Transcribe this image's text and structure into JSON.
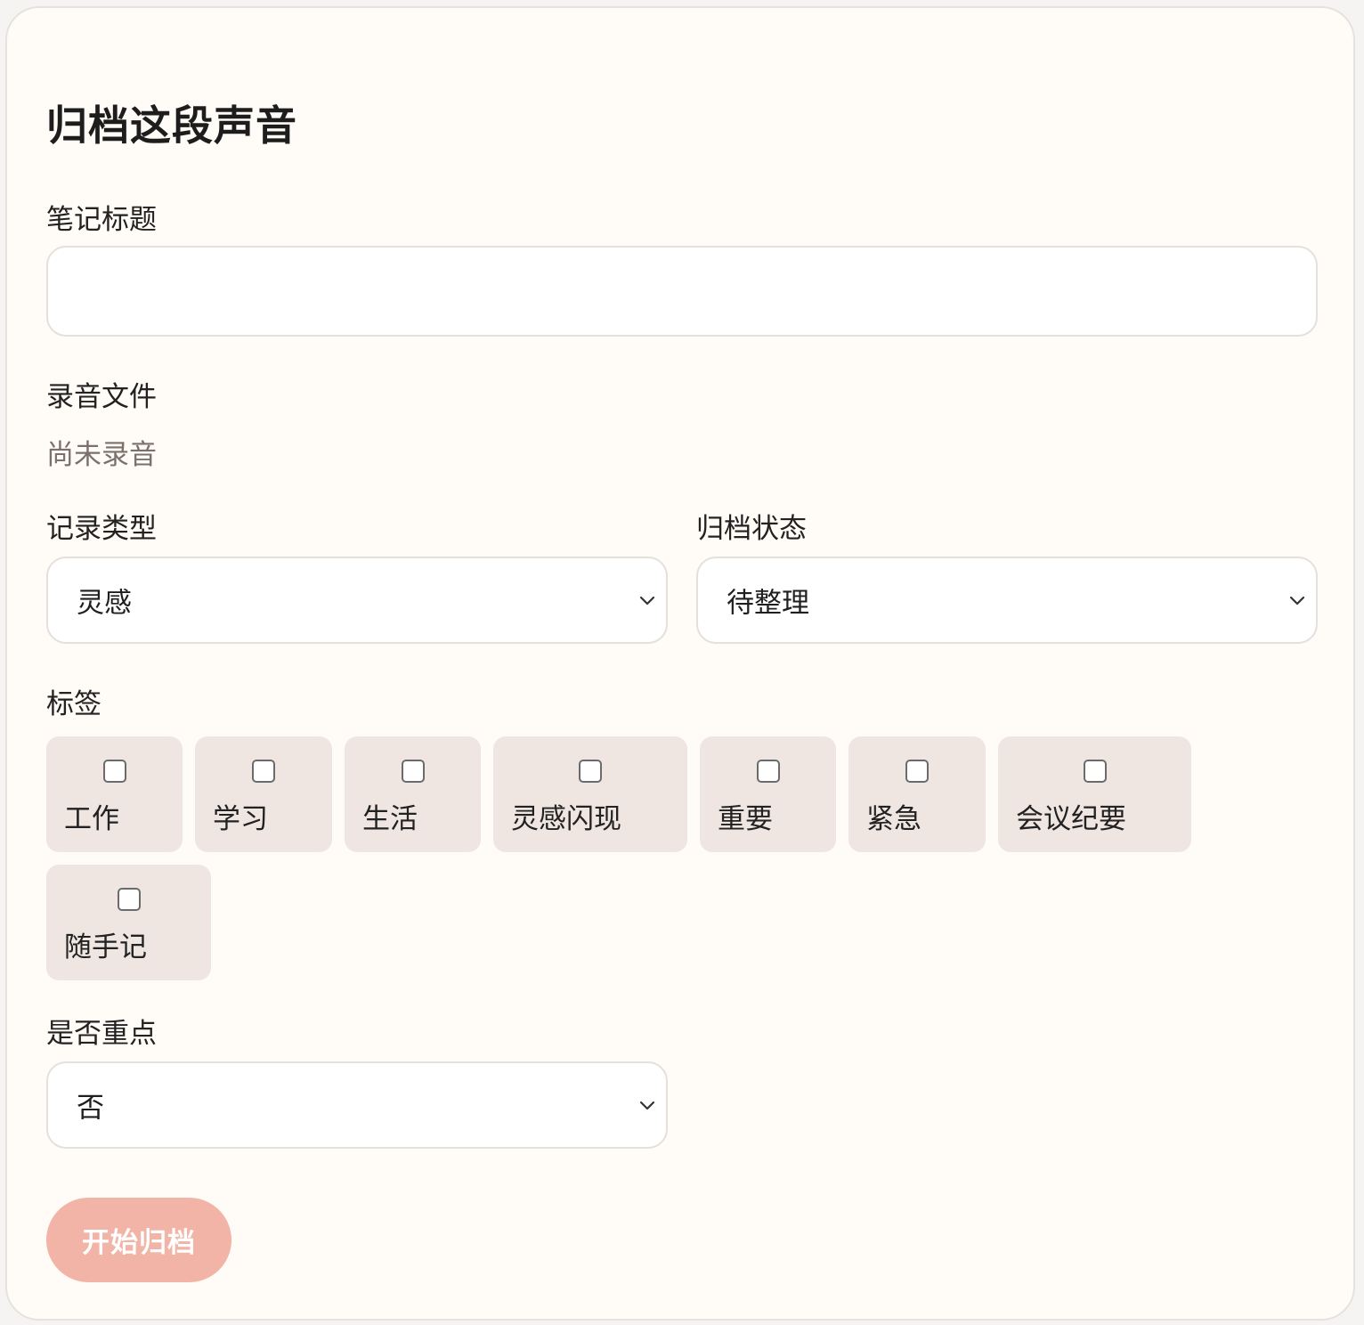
{
  "form": {
    "title": "归档这段声音",
    "note_title": {
      "label": "笔记标题",
      "value": "",
      "placeholder": ""
    },
    "recording": {
      "label": "录音文件",
      "status": "尚未录音"
    },
    "record_type": {
      "label": "记录类型",
      "selected": "灵感"
    },
    "archive_status": {
      "label": "归档状态",
      "selected": "待整理"
    },
    "tags": {
      "label": "标签",
      "items": [
        {
          "label": "工作",
          "checked": false
        },
        {
          "label": "学习",
          "checked": false
        },
        {
          "label": "生活",
          "checked": false
        },
        {
          "label": "灵感闪现",
          "checked": false
        },
        {
          "label": "重要",
          "checked": false
        },
        {
          "label": "紧急",
          "checked": false
        },
        {
          "label": "会议纪要",
          "checked": false
        },
        {
          "label": "随手记",
          "checked": false
        }
      ]
    },
    "important": {
      "label": "是否重点",
      "selected": "否"
    },
    "submit_label": "开始归档"
  },
  "colors": {
    "card_bg": "#fffbf6",
    "tag_bg": "#efe6e2",
    "button_bg": "#f2b4a6",
    "muted_text": "#7a716a"
  },
  "icons": {
    "select_arrow": "chevron-down-icon"
  }
}
